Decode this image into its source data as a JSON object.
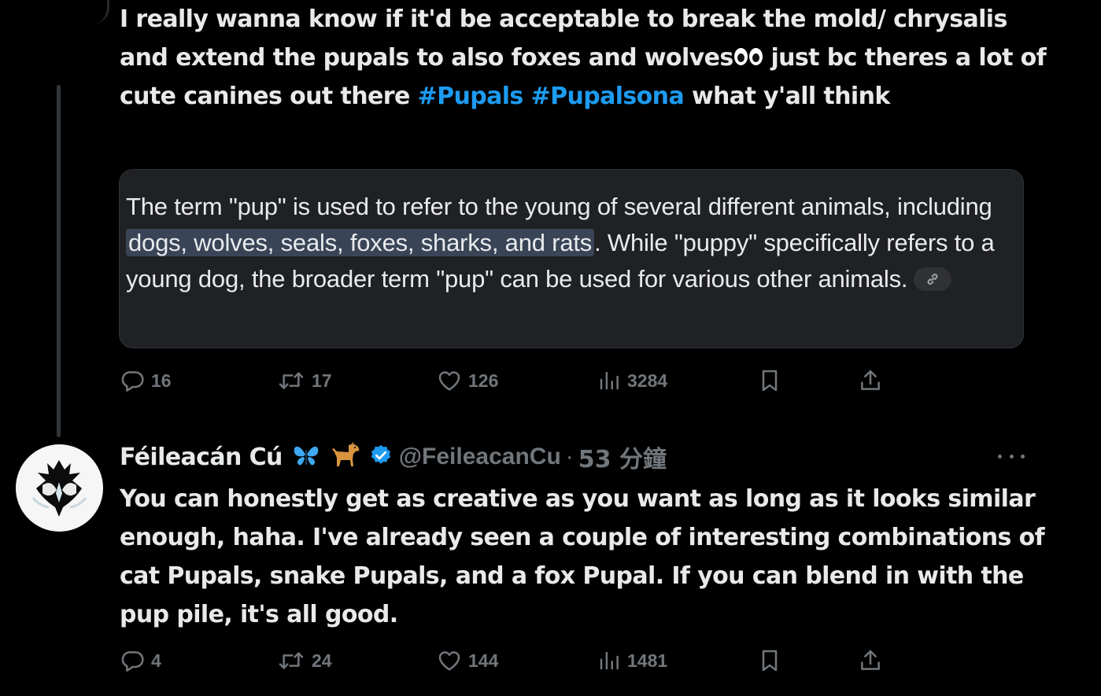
{
  "tweet1": {
    "text_before": "I really wanna know if it'd be acceptable to break the mold/ chrysalis and extend the pupals to also foxes and wolves",
    "text_mid": " just bc theres a lot of cute canines out there ",
    "hashtags": [
      "#Pupals",
      "#Pupalsona"
    ],
    "text_after": " what y'all think",
    "eyes_emoji_icon": "eyes-emoji-icon",
    "quote": {
      "before": "The term \"pup\" is used to refer to the young of several different animals, including ",
      "highlight": "dogs, wolves, seals, foxes, sharks, and rats",
      "after": ". While \"puppy\" specifically refers to a young dog, the broader term \"pup\" can be used for various other animals.",
      "link_icon": "link-icon"
    },
    "stats": {
      "replies": "16",
      "reposts": "17",
      "likes": "126",
      "views": "3284"
    }
  },
  "tweet2": {
    "author": "Féileacán Cú",
    "handle": "@FeileacanCu",
    "separator": "·",
    "time": "53 分鐘",
    "emojis": [
      "butterfly-emoji-icon",
      "dog-emoji-icon"
    ],
    "text": "You can honestly get as creative as you want as long as it looks similar enough, haha. I've already seen a couple of interesting combinations of cat Pupals, snake Pupals, and a fox Pupal. If you can blend in with the pup pile, it's all good.",
    "stats": {
      "replies": "4",
      "reposts": "24",
      "likes": "144",
      "views": "1481"
    }
  },
  "colors": {
    "background": "#000000",
    "text": "#e7e9ea",
    "muted": "#71767b",
    "hashtag": "#1d9bf0",
    "verified": "#1d9bf0",
    "highlight": "#394457"
  }
}
